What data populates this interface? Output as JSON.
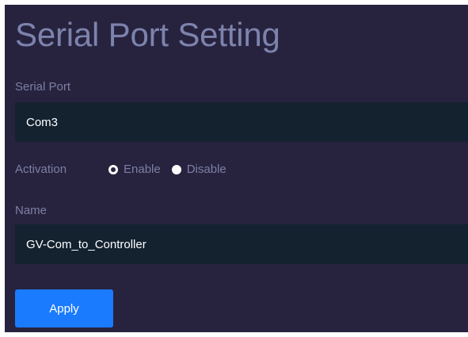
{
  "page": {
    "title": "Serial Port Setting"
  },
  "serial_port": {
    "label": "Serial Port",
    "value": "Com3"
  },
  "activation": {
    "label": "Activation",
    "options": [
      {
        "label": "Enable",
        "selected": true
      },
      {
        "label": "Disable",
        "selected": false
      }
    ]
  },
  "name": {
    "label": "Name",
    "value": "GV-Com_to_Controller"
  },
  "actions": {
    "apply_label": "Apply"
  },
  "colors": {
    "background": "#27233f",
    "field": "#142230",
    "accent": "#1a7bff",
    "title": "#7d83ad",
    "label": "#7d7fa3"
  }
}
